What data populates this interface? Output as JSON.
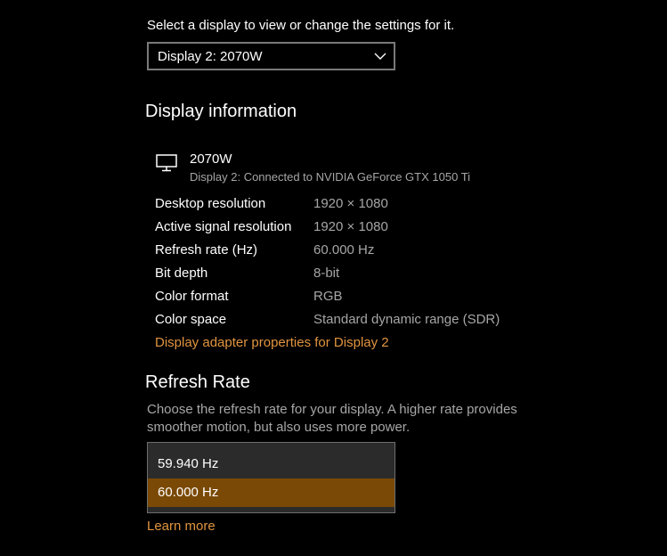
{
  "display_selector": {
    "label": "Select a display to view or change the settings for it.",
    "selected": "Display 2: 2070W",
    "chevron_icon": "chevron-down-icon"
  },
  "display_information": {
    "heading": "Display information",
    "monitor_icon": "monitor-icon",
    "name": "2070W",
    "connection": "Display 2: Connected to NVIDIA GeForce GTX 1050 Ti",
    "rows": [
      {
        "label": "Desktop resolution",
        "value": "1920 × 1080"
      },
      {
        "label": "Active signal resolution",
        "value": "1920 × 1080"
      },
      {
        "label": "Refresh rate (Hz)",
        "value": "60.000 Hz"
      },
      {
        "label": "Bit depth",
        "value": "8-bit"
      },
      {
        "label": "Color format",
        "value": "RGB"
      },
      {
        "label": "Color space",
        "value": "Standard dynamic range (SDR)"
      }
    ],
    "adapter_link": "Display adapter properties for Display 2"
  },
  "refresh_rate": {
    "heading": "Refresh Rate",
    "description": "Choose the refresh rate for your display. A higher rate provides smoother motion, but also uses more power.",
    "options": [
      "59.940 Hz",
      "60.000 Hz"
    ],
    "selected": "60.000 Hz",
    "learn_more": "Learn more"
  },
  "colors": {
    "background": "#000000",
    "accent_link": "#e0943f",
    "selected_option": "#7a4905",
    "secondary_text": "#a6a6a6"
  }
}
